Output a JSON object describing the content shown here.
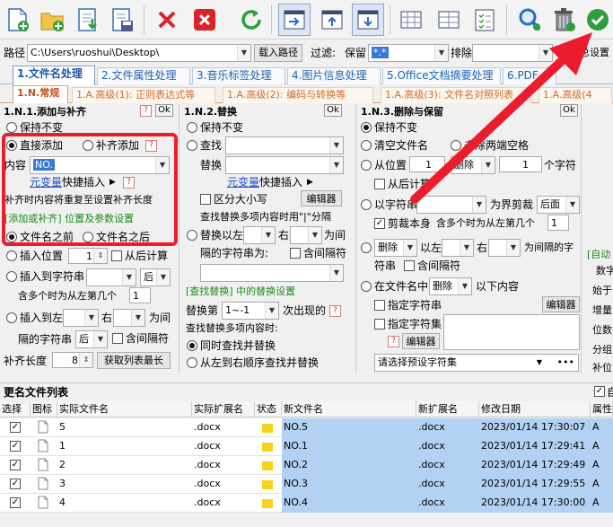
{
  "toolbar": {
    "buttons": [
      "add-files-icon",
      "add-folder-icon",
      "import-list-icon",
      "save-list-icon",
      "remove-icon",
      "clear-icon",
      "refresh-icon",
      "import-path-icon",
      "move-up-icon",
      "move-down-icon",
      "columns-icon",
      "grid-icon",
      "checklist-icon",
      "search-icon",
      "delete-icon",
      "execute-icon"
    ]
  },
  "path_bar": {
    "path_label": "路径",
    "path_value": "C:\\Users\\ruoshui\\Desktop\\",
    "load_button": "载入路径",
    "filter_label": "过滤:",
    "keep_label": "保留",
    "keep_value": "*.*",
    "exclude_label": "排除",
    "settings_label": "总设置"
  },
  "main_tabs": [
    "1.文件名处理",
    "2.文件属性处理",
    "3.音乐标签处理",
    "4.图片信息处理",
    "5.Office文档摘要处理",
    "6.PDF"
  ],
  "sub_tabs": [
    "1.N.常规",
    "1.A.高级(1): 正则表达式等",
    "1.A.高级(2): 编码与转换等",
    "1.A.高级(3): 文件名对照列表",
    "1.A.高级(4"
  ],
  "panel1": {
    "title": "1.N.1.添加与补齐",
    "ok": "Ok",
    "help": "?",
    "keep_unchanged": "保持不变",
    "direct_add": "直接添加",
    "pad_add": "补齐添加",
    "content_label": "内容",
    "content_value": "NO.",
    "var_link": "元变量",
    "quick_insert": "快捷插入",
    "repeat_note": "补齐时内容将重复至设置补齐长度",
    "position_title": "[添加或补齐] 位置及参数设置",
    "before_name": "文件名之前",
    "after_name": "文件名之后",
    "insert_pos": "插入位置",
    "insert_pos_value": "1",
    "from_back": "从后计算",
    "insert_to_str": "插入到字符串",
    "after_opt": "后",
    "multi_note": "含多个时为从左第几个",
    "nth_value": "1",
    "insert_left": "插入到左",
    "right_label": "右",
    "gap_label": "为间",
    "gap_str": "隔的字符串",
    "after_opt2": "后",
    "include_gap": "含间隔符",
    "pad_len_label": "补齐长度",
    "pad_len_value": "8",
    "get_max_button": "获取列表最长"
  },
  "panel2": {
    "title": "1.N.2.替换",
    "ok": "Ok",
    "keep_unchanged": "保持不变",
    "find_label": "查找",
    "replace_label": "替换",
    "var_link": "元变量",
    "quick_insert": "快捷插入",
    "case_sensitive": "区分大小写",
    "editor": "编辑器",
    "find_note": "查找替换多项内容时用\"|\"分隔",
    "replace_left": "替换以左",
    "right_label": "右",
    "gap_label": "为间",
    "gap_str": "隔的字符串为:",
    "include_gap": "含间隔符",
    "sub_title": "[查找替换] 中的替换设置",
    "replace_nth": "替换第",
    "nth_value": "1~-1",
    "occurrence": "次出现的",
    "multi_note": "查找替换多项内容时:",
    "simultaneous": "同时查找并替换",
    "sequential": "从左到右顺序查找并替换"
  },
  "panel3": {
    "title": "1.N.3.删除与保留",
    "ok": "Ok",
    "keep_unchanged": "保持不变",
    "clear_name": "清空文件名",
    "remove_spaces": "去除两端空格",
    "from_pos": "从位置",
    "from_pos_value": "1",
    "delete_opt": "删除",
    "count_value": "1",
    "chars_label": "个字符",
    "from_back": "从后计算",
    "with_str": "以字符串",
    "boundary": "为界剪裁",
    "after_opt": "后面",
    "cut_self": "剪裁本身",
    "multi_note": "含多个时为从左第几个",
    "nth_value": "1",
    "delete_opt2": "删除",
    "left_label": "以左",
    "right_label": "右",
    "gap_label": "为间隔的字",
    "str_label": "符串",
    "include_gap": "含间隔符",
    "in_name": "在文件名中",
    "delete_opt3": "删除",
    "content_below": "以下内容",
    "specify_str": "指定字符串",
    "editor": "编辑器",
    "specify_set": "指定字符集",
    "editor2": "编辑器",
    "preset_placeholder": "请选择预设字符集",
    "more": "•••"
  },
  "panel4": {
    "partial": [
      "[自动",
      "数字",
      "始于",
      "增量",
      "位数",
      "分组",
      "补位"
    ]
  },
  "list": {
    "title": "更名文件列表",
    "auto_label": "自",
    "columns": [
      "选择",
      "图标",
      "实际文件名",
      "实际扩展名",
      "状态",
      "新文件名",
      "新扩展名",
      "修改日期",
      "属性"
    ],
    "rows": [
      {
        "checked": true,
        "name": "5",
        "ext": ".docx",
        "new_name": "NO.5",
        "new_ext": ".docx",
        "date": "2023/01/14 17:30:07",
        "attr": "A"
      },
      {
        "checked": true,
        "name": "1",
        "ext": ".docx",
        "new_name": "NO.1",
        "new_ext": ".docx",
        "date": "2023/01/14 17:29:41",
        "attr": "A"
      },
      {
        "checked": true,
        "name": "2",
        "ext": ".docx",
        "new_name": "NO.2",
        "new_ext": ".docx",
        "date": "2023/01/14 17:29:49",
        "attr": "A"
      },
      {
        "checked": true,
        "name": "3",
        "ext": ".docx",
        "new_name": "NO.3",
        "new_ext": ".docx",
        "date": "2023/01/14 17:29:55",
        "attr": "A"
      },
      {
        "checked": true,
        "name": "4",
        "ext": ".docx",
        "new_name": "NO.4",
        "new_ext": ".docx",
        "date": "2023/01/14 17:30:00",
        "attr": "A"
      }
    ]
  },
  "colors": {
    "highlight_red": "#ec1c2d",
    "tab_blue": "#1f63b5",
    "subtab_orange": "#d26b2a",
    "selection": "#b3d1f2",
    "status_yellow": "#f5d21c"
  }
}
